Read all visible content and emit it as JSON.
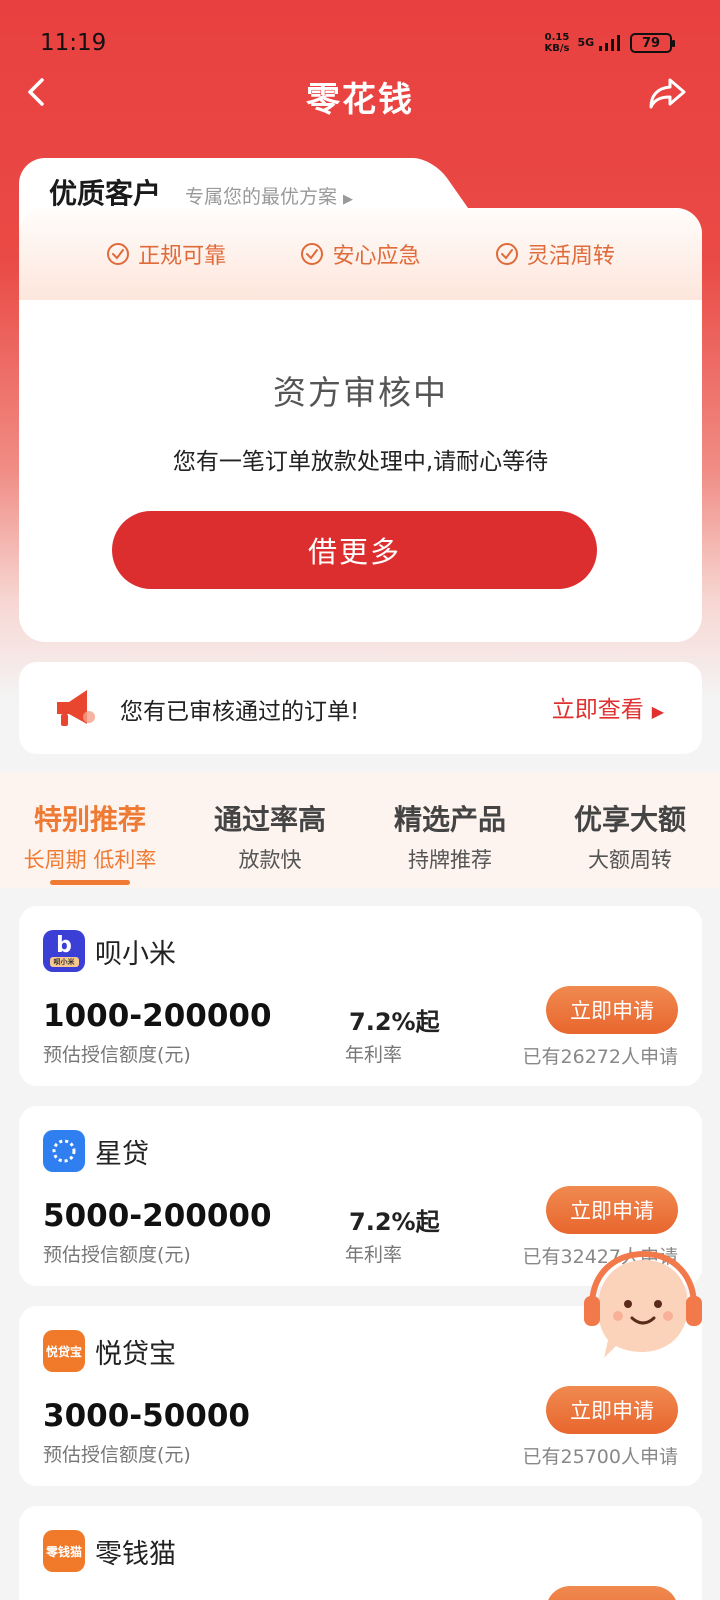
{
  "status_bar": {
    "time": "11:19",
    "speed_value": "0.15",
    "speed_unit": "KB/s",
    "network": "5G",
    "battery": "79"
  },
  "nav": {
    "title": "零花钱",
    "back_icon": "chevron-left-icon",
    "share_icon": "share-icon"
  },
  "hero": {
    "badge_title": "优质客户",
    "badge_subtitle": "专属您的最优方案",
    "features": [
      {
        "label": "正规可靠",
        "icon": "check-circle-icon"
      },
      {
        "label": "安心应急",
        "icon": "check-circle-icon"
      },
      {
        "label": "灵活周转",
        "icon": "check-circle-icon"
      }
    ],
    "status_title": "资方审核中",
    "status_desc": "您有一笔订单放款处理中,请耐心等待",
    "button_label": "借更多"
  },
  "notice": {
    "icon": "megaphone-icon",
    "text": "您有已审核通过的订单!",
    "link_label": "立即查看"
  },
  "tabs": [
    {
      "main": "特别推荐",
      "sub": "长周期 低利率",
      "active": true
    },
    {
      "main": "通过率高",
      "sub": "放款快",
      "active": false
    },
    {
      "main": "精选产品",
      "sub": "持牌推荐",
      "active": false
    },
    {
      "main": "优享大额",
      "sub": "大额周转",
      "active": false
    }
  ],
  "products": [
    {
      "name": "呗小米",
      "logo_text": "b",
      "logo_caption": "呗小米",
      "amount": "1000-200000",
      "amount_label": "预估授信额度(元)",
      "rate": "7.2%起",
      "rate_label": "年利率",
      "button": "立即申请",
      "applicants": "已有26272人申请",
      "logo_color": "#3b3fd6"
    },
    {
      "name": "星贷",
      "logo_text": "",
      "amount": "5000-200000",
      "amount_label": "预估授信额度(元)",
      "rate": "7.2%起",
      "rate_label": "年利率",
      "button": "立即申请",
      "applicants": "已有32427人申请",
      "logo_color": "#2f7ff0"
    },
    {
      "name": "悦贷宝",
      "logo_text": "悦贷宝",
      "amount": "3000-50000",
      "amount_label": "预估授信额度(元)",
      "rate": "",
      "rate_label": "",
      "button": "立即申请",
      "applicants": "已有25700人申请",
      "logo_color": "#f07a2a"
    },
    {
      "name": "零钱猫",
      "logo_text": "零钱猫",
      "amount": "",
      "amount_label": "",
      "rate": "",
      "rate_label": "",
      "button": "",
      "applicants": "",
      "logo_color": "#f07a2a"
    }
  ],
  "mascot": {
    "icon": "customer-service-mascot-icon"
  },
  "colors": {
    "brand_red": "#e84040",
    "button_red": "#dc2e2e",
    "accent_orange": "#ee7a34"
  }
}
